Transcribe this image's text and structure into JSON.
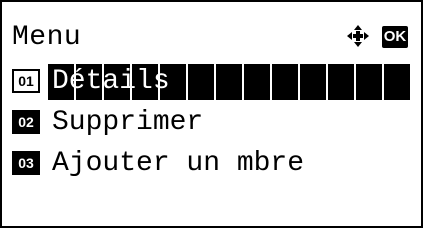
{
  "header": {
    "title": "Menu",
    "nav_icon": "four-way-arrow-icon",
    "ok_label": "OK"
  },
  "menu": {
    "items": [
      {
        "number": "01",
        "label": "Détails",
        "selected": true
      },
      {
        "number": "02",
        "label": "Supprimer",
        "selected": false
      },
      {
        "number": "03",
        "label": "Ajouter un mbre",
        "selected": false
      }
    ]
  },
  "colors": {
    "background": "#ffffff",
    "foreground": "#000000"
  }
}
